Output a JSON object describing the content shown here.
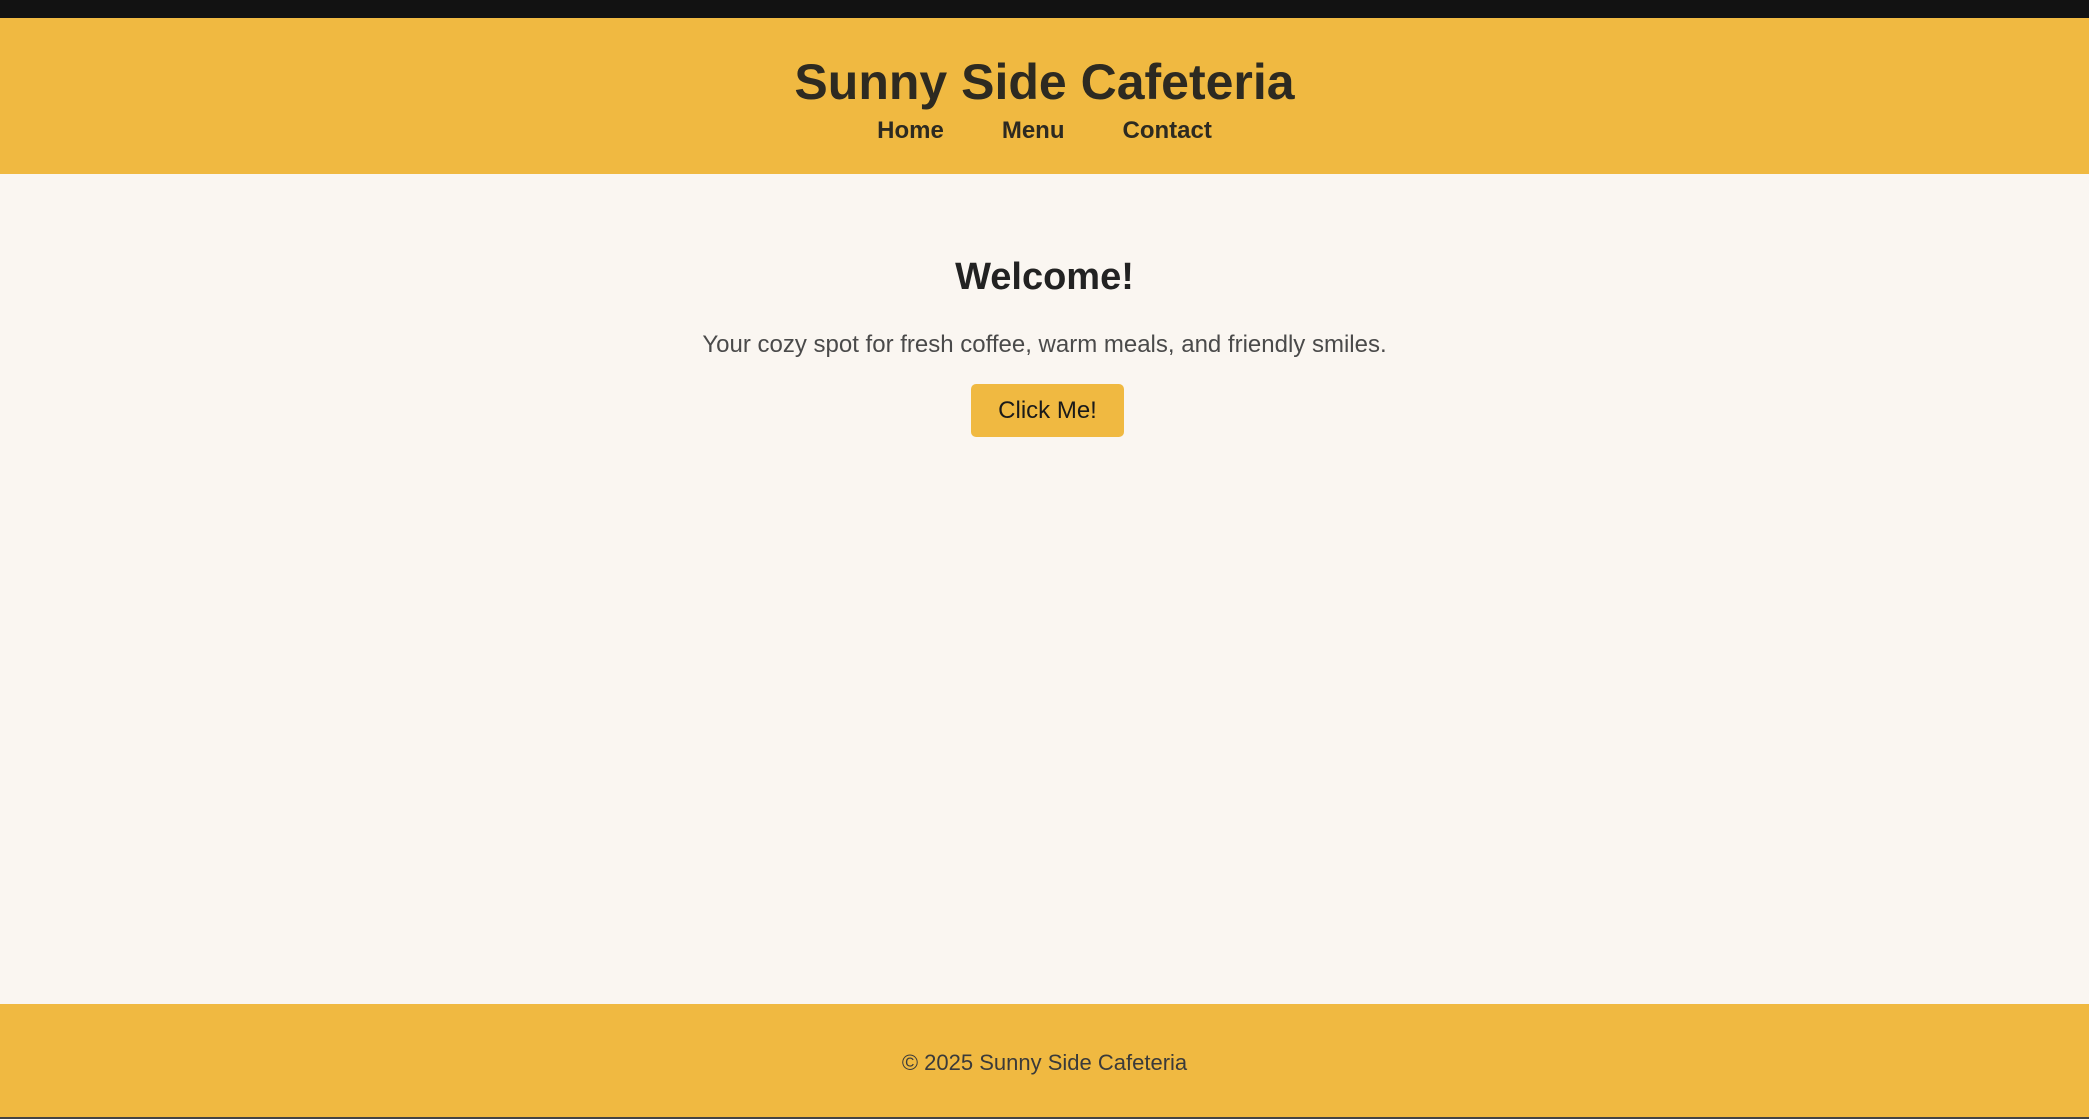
{
  "header": {
    "title": "Sunny Side Cafeteria",
    "nav": [
      {
        "label": "Home"
      },
      {
        "label": "Menu"
      },
      {
        "label": "Contact"
      }
    ]
  },
  "main": {
    "heading": "Welcome!",
    "tagline": "Your cozy spot for fresh coffee, warm meals, and friendly smiles.",
    "button_label": "Click Me!"
  },
  "footer": {
    "copyright": "© 2025 Sunny Side Cafeteria"
  },
  "colors": {
    "accent": "#f0b941",
    "background": "#faf6f1",
    "text": "#2d2a21"
  }
}
